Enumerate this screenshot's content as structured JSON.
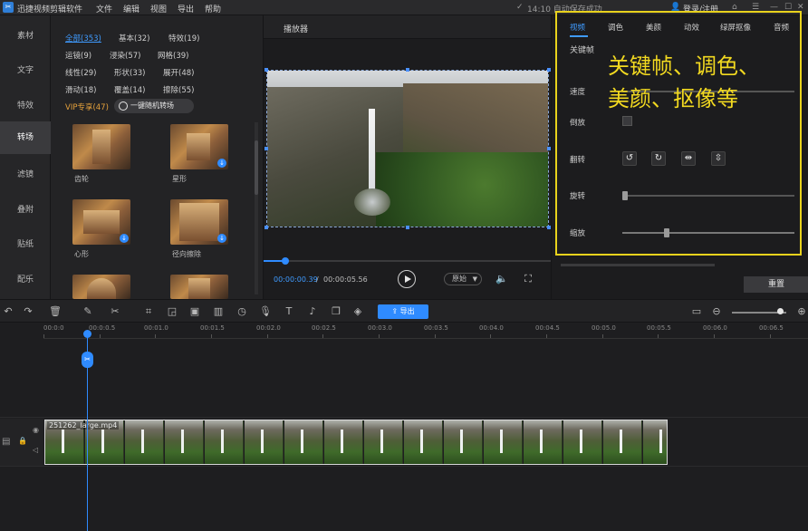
{
  "titlebar": {
    "app_name": "迅捷视频剪辑软件",
    "menus": [
      "文件",
      "编辑",
      "视图",
      "导出",
      "帮助"
    ],
    "autosave": "14:10 自动保存成功",
    "login": "登录/注册"
  },
  "sidebar": {
    "items": [
      {
        "label": "素材"
      },
      {
        "label": "文字"
      },
      {
        "label": "特效"
      },
      {
        "label": "转场"
      },
      {
        "label": "滤镜"
      },
      {
        "label": "叠附"
      },
      {
        "label": "贴纸"
      },
      {
        "label": "配乐"
      }
    ],
    "active_index": 3
  },
  "library": {
    "categories": [
      {
        "label": "全部(353)"
      },
      {
        "label": "基本(32)"
      },
      {
        "label": "特效(19)"
      },
      {
        "label": "运镜(9)"
      },
      {
        "label": "浸染(57)"
      },
      {
        "label": "网格(39)"
      },
      {
        "label": "线性(29)"
      },
      {
        "label": "形状(33)"
      },
      {
        "label": "展开(48)"
      },
      {
        "label": "滑动(18)"
      },
      {
        "label": "覆盖(14)"
      },
      {
        "label": "擦除(55)"
      },
      {
        "label": "VIP专享(47)"
      }
    ],
    "random_button": "一键随机转场",
    "thumbs": [
      {
        "label": "齿轮"
      },
      {
        "label": "星形"
      },
      {
        "label": "心形"
      },
      {
        "label": "径向擦除"
      },
      {
        "label": ""
      },
      {
        "label": ""
      }
    ]
  },
  "player": {
    "title": "播放器",
    "current_time": "00:00:00.39",
    "separator": "/",
    "total_time": "00:00:05.56",
    "ratio": "原始",
    "progress_fraction": 0.07
  },
  "properties": {
    "tabs": [
      "视频",
      "调色",
      "美颜",
      "动效",
      "绿屏抠像",
      "音频"
    ],
    "active_tab": 0,
    "keyframe_tab": "关键帧",
    "overlay_line1": "关键帧、调色、",
    "overlay_line2": "美颜、抠像等",
    "speed_label": "速度",
    "reverse_label": "倒放",
    "flip_label": "翻转",
    "rotate_label": "旋转",
    "scale_label": "缩放",
    "reset_button": "重置",
    "highlight_color": "#e8d21c"
  },
  "timeline": {
    "export_button": "导出",
    "ruler": [
      "00:0:0",
      "00:0:0.5",
      "00:01.0",
      "00:01.5",
      "00:02.0",
      "00:02.5",
      "00:03.0",
      "00:03.5",
      "00:04.0",
      "00:04.5",
      "00:05.0",
      "00:05.5",
      "00:06.0",
      "00:06.5"
    ],
    "clip_name": "251262_large.mp4",
    "accent": "#2f8bff"
  }
}
